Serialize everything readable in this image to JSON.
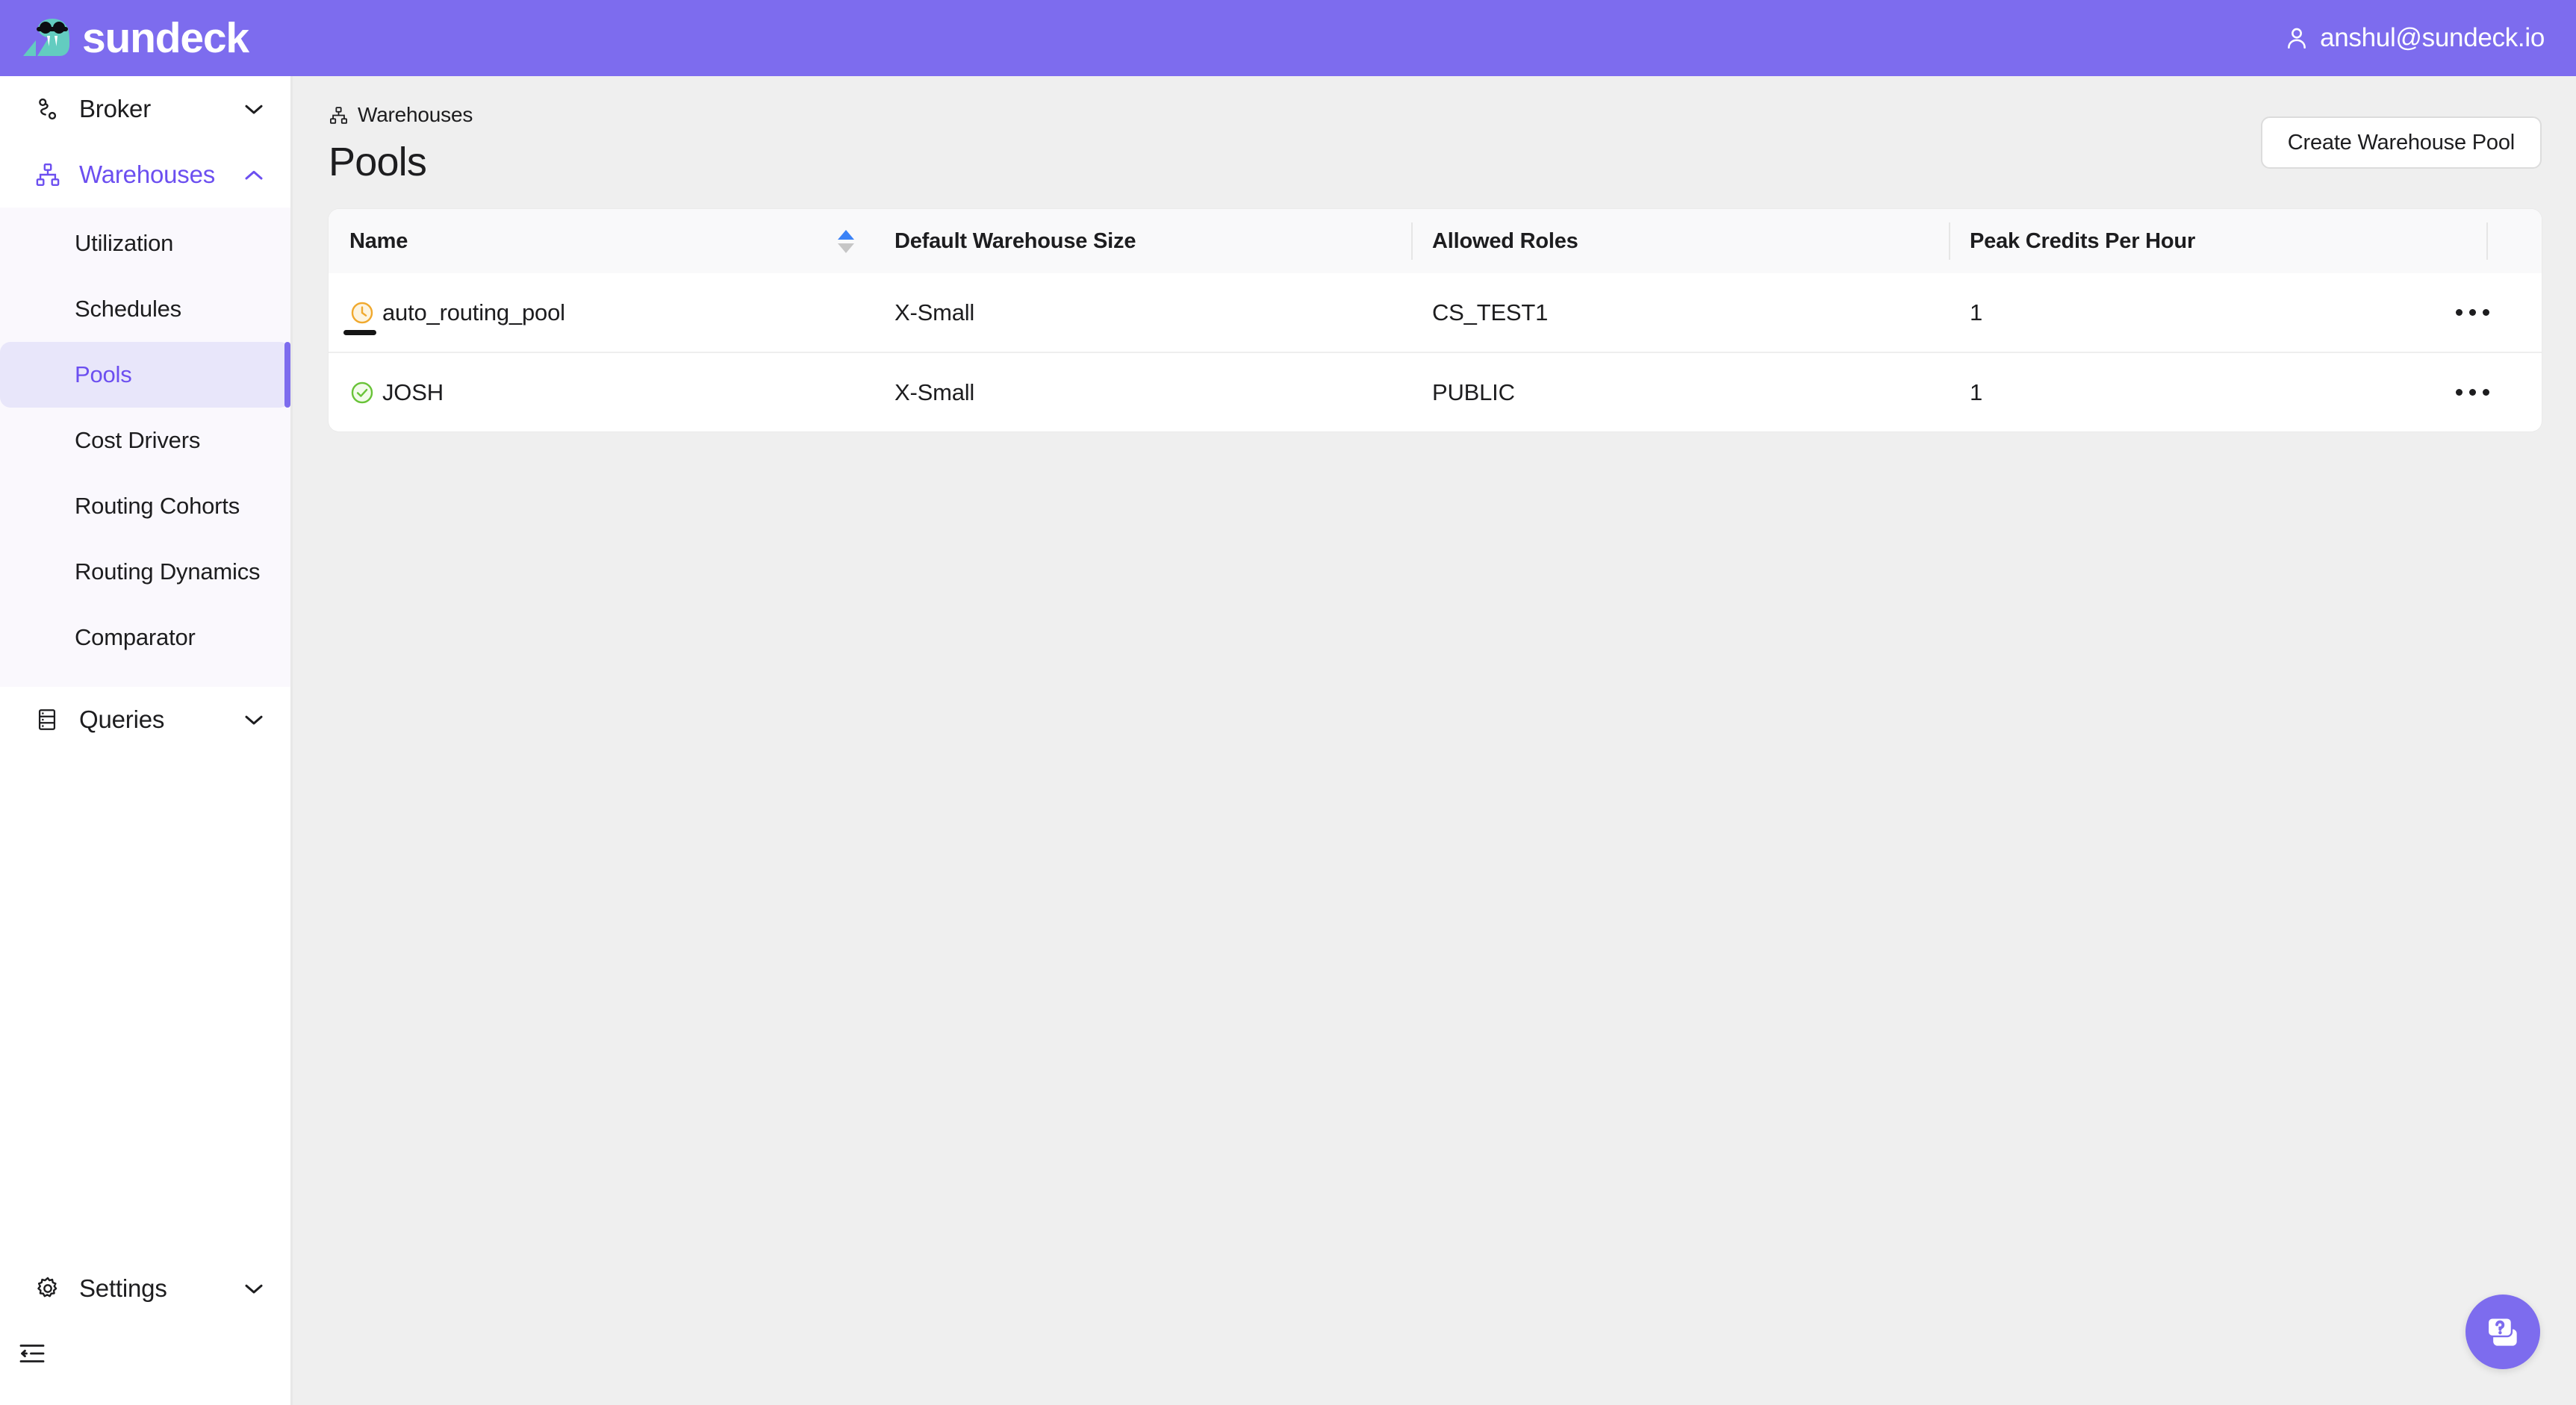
{
  "topbar": {
    "brand_name": "sundeck",
    "logo_icon": "walrus-logo",
    "user_icon": "user-icon",
    "user_email": "anshul@sundeck.io",
    "background_color": "#7d6cee"
  },
  "sidebar": {
    "groups": [
      {
        "label": "Broker",
        "icon": "broker-route-icon",
        "expanded": false,
        "active": false,
        "chevron": "chevron-down-icon"
      },
      {
        "label": "Warehouses",
        "icon": "warehouses-hierarchy-icon",
        "expanded": true,
        "active": true,
        "chevron": "chevron-up-icon"
      }
    ],
    "warehouses_items": [
      {
        "label": "Utilization",
        "selected": false
      },
      {
        "label": "Schedules",
        "selected": false
      },
      {
        "label": "Pools",
        "selected": true
      },
      {
        "label": "Cost Drivers",
        "selected": false
      },
      {
        "label": "Routing Cohorts",
        "selected": false
      },
      {
        "label": "Routing Dynamics",
        "selected": false
      },
      {
        "label": "Comparator",
        "selected": false
      }
    ],
    "queries": {
      "label": "Queries",
      "icon": "queries-server-icon",
      "chevron": "chevron-down-icon"
    },
    "settings": {
      "label": "Settings",
      "icon": "gear-icon",
      "chevron": "chevron-down-icon"
    },
    "collapse": {
      "icon": "collapse-sidebar-icon"
    },
    "accent_color": "#6c4ff0",
    "selected_background": "#e8e6fa",
    "submenu_background": "#faf8fd"
  },
  "main": {
    "breadcrumb": {
      "icon": "warehouses-hierarchy-icon",
      "label": "Warehouses"
    },
    "page_title": "Pools",
    "create_button": "Create Warehouse Pool",
    "help_button": {
      "icon": "help-question-cards-icon",
      "color": "#7d6cee"
    }
  },
  "table": {
    "columns": [
      {
        "label": "Name",
        "sortable": true,
        "sort_state": "asc",
        "divider": false
      },
      {
        "label": "Default Warehouse Size",
        "sortable": false,
        "divider": false
      },
      {
        "label": "Allowed Roles",
        "sortable": false,
        "divider": true
      },
      {
        "label": "Peak Credits Per Hour",
        "sortable": false,
        "divider": true
      },
      {
        "label": "",
        "sortable": false,
        "divider": true
      }
    ],
    "rows": [
      {
        "status_icon": "clock-pending-icon",
        "status_color": "#f0a92e",
        "name": "auto_routing_pool",
        "default_warehouse_size": "X-Small",
        "allowed_roles": "CS_TEST1",
        "peak_credits_per_hour": "1",
        "menu_icon": "more-options-icon",
        "delete_icon": "trash-icon"
      },
      {
        "status_icon": "check-circle-active-icon",
        "status_color": "#69c338",
        "name": "JOSH",
        "default_warehouse_size": "X-Small",
        "allowed_roles": "PUBLIC",
        "peak_credits_per_hour": "1",
        "menu_icon": "more-options-icon",
        "delete_icon": "trash-icon"
      }
    ]
  }
}
